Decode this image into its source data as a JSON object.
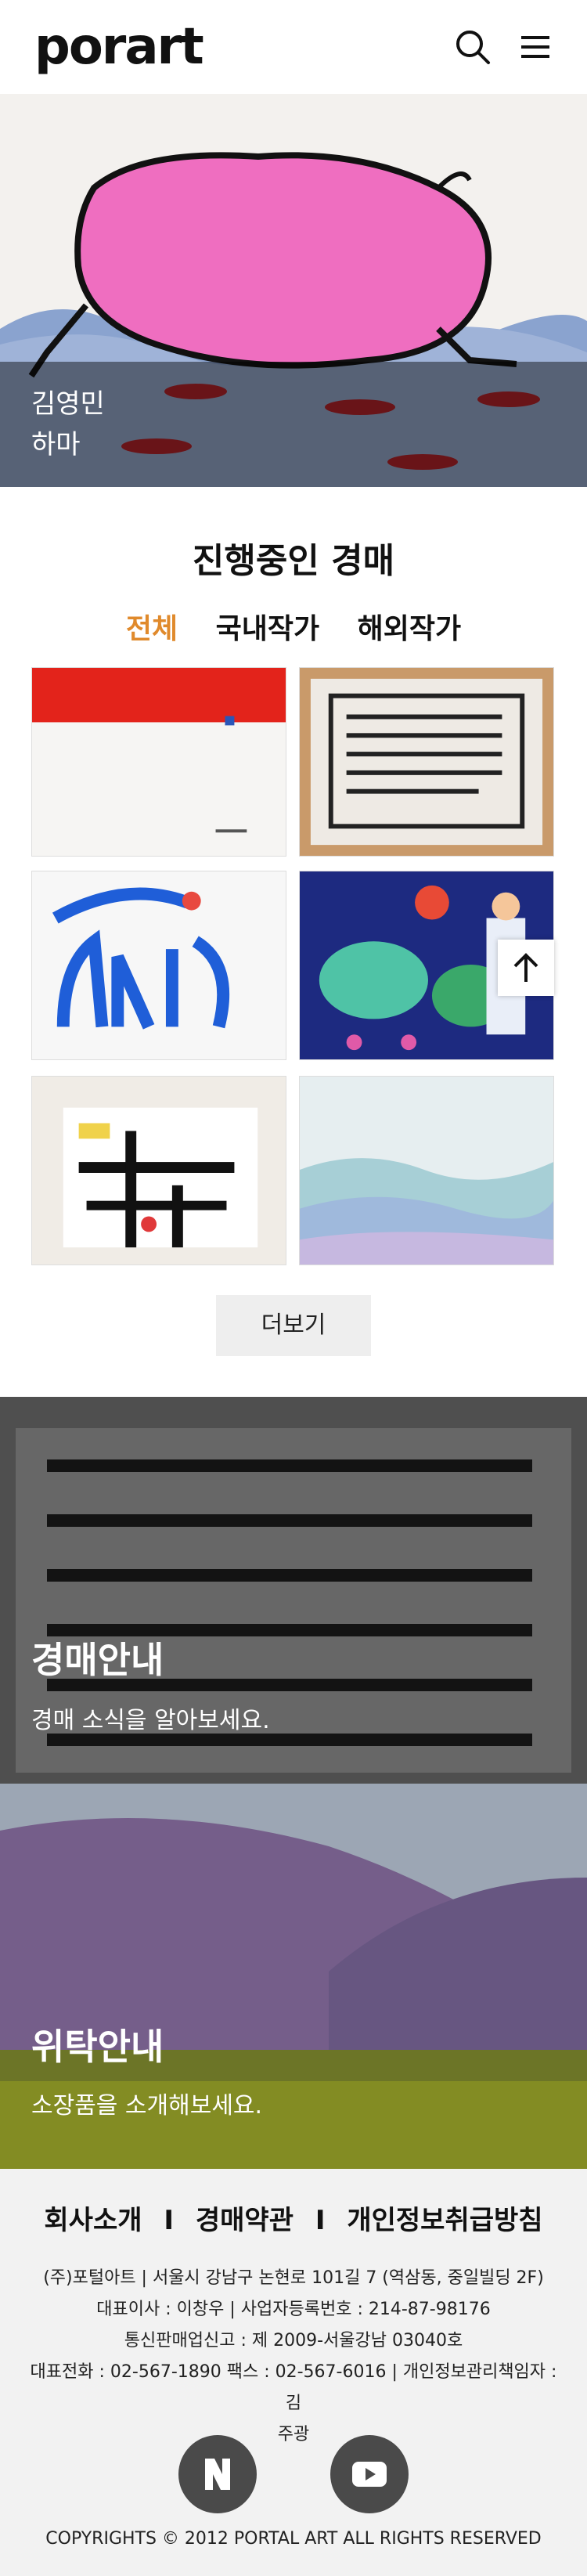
{
  "header": {
    "logo": "porart"
  },
  "hero": {
    "artist": "김영민",
    "title": "하마"
  },
  "auction": {
    "section_title": "진행중인 경매",
    "tabs": [
      "전체",
      "국내작가",
      "해외작가"
    ],
    "more_label": "더보기"
  },
  "info_banners": [
    {
      "title": "경매안내",
      "subtitle": "경매 소식을 알아보세요."
    },
    {
      "title": "위탁안내",
      "subtitle": "소장품을 소개해보세요."
    }
  ],
  "footer": {
    "links": [
      "회사소개",
      "경매약관",
      "개인정보취급방침"
    ],
    "separator": "I",
    "info_lines": [
      "(주)포털아트 | 서울시 강남구 논현로 101길 7 (역삼동, 중일빌딩 2F)",
      "대표이사 : 이창우 | 사업자등록번호 : 214-87-98176",
      "통신판매업신고 : 제 2009-서울강남 03040호",
      "대표전화 : 02-567-1890 팩스 : 02-567-6016 | 개인정보관리책임자 :김",
      "주광"
    ],
    "copyright": "COPYRIGHTS © 2012 PORTAL ART ALL RIGHTS RESERVED"
  },
  "colors": {
    "accent": "#e08a2c",
    "footer_bg": "#f2f2f2",
    "social_bg": "#4a4a4a"
  },
  "icons": [
    "search-icon",
    "menu-icon",
    "arrow-up-icon",
    "naver-icon",
    "youtube-icon"
  ]
}
